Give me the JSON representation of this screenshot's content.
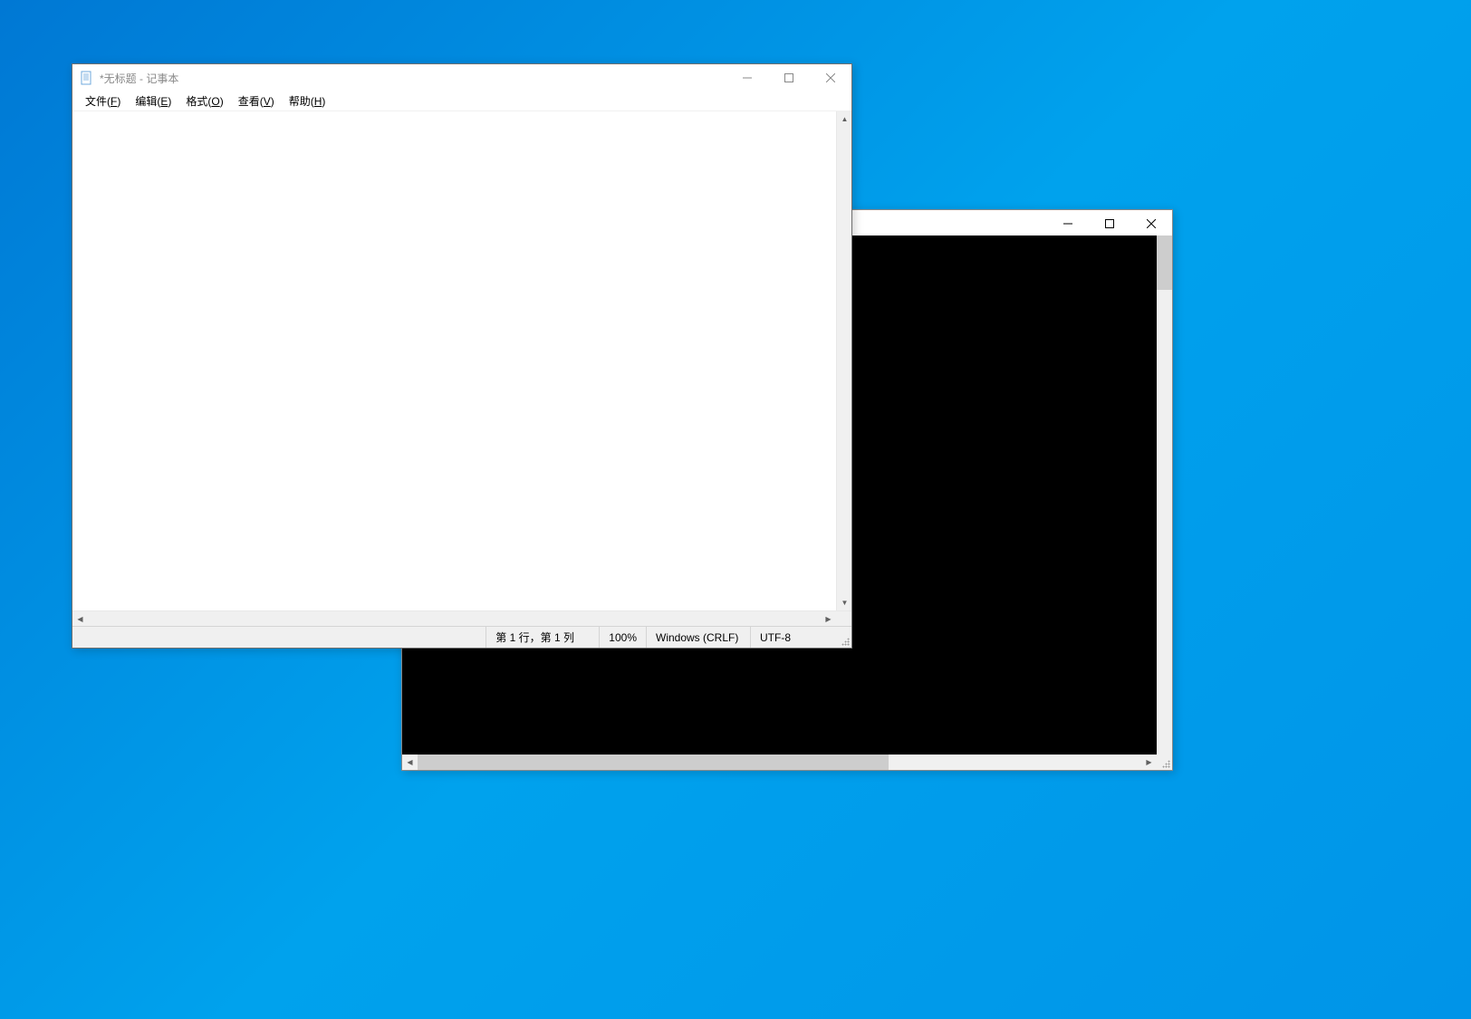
{
  "notepad": {
    "title": "*无标题 - 记事本",
    "menu": {
      "file": "文件(F)",
      "edit": "编辑(E)",
      "format": "格式(O)",
      "view": "查看(V)",
      "help": "帮助(H)"
    },
    "content": "",
    "statusbar": {
      "position": "第 1 行，第 1 列",
      "zoom": "100%",
      "lineending": "Windows (CRLF)",
      "encoding": "UTF-8"
    }
  },
  "console": {
    "title": ""
  }
}
